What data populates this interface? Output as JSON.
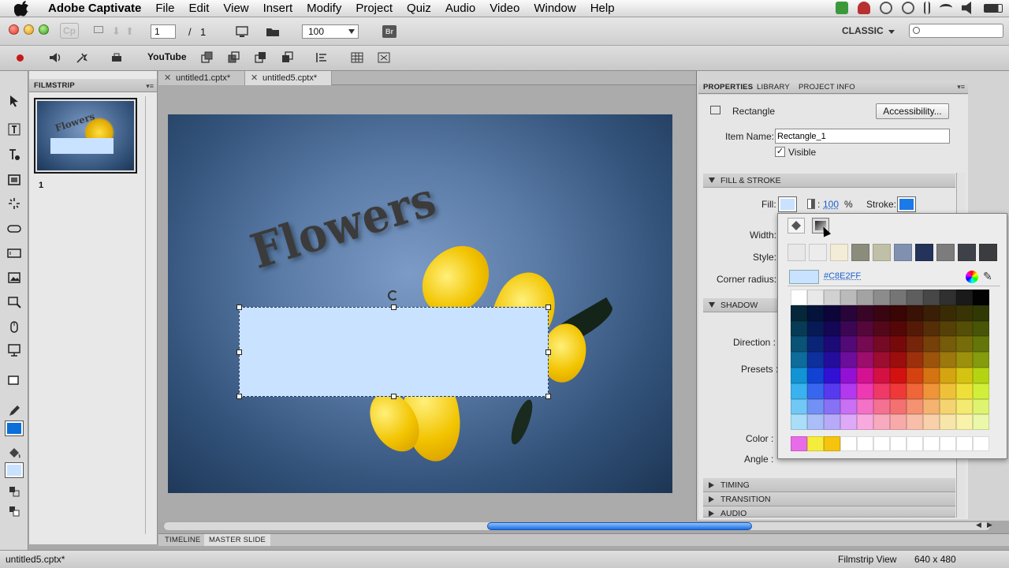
{
  "menubar": {
    "app_name": "Adobe Captivate",
    "menus": [
      "File",
      "Edit",
      "View",
      "Insert",
      "Modify",
      "Project",
      "Quiz",
      "Audio",
      "Video",
      "Window",
      "Help"
    ]
  },
  "toolbar": {
    "slide_current": "1",
    "slide_separator": "/",
    "slide_total": "1",
    "zoom": "100",
    "bridge_label": "Br",
    "youtube_label": "YouTube",
    "workspace": "CLASSIC",
    "search_placeholder": ""
  },
  "filmstrip": {
    "tab_label": "FILMSTRIP",
    "slides": [
      {
        "number": "1",
        "title_text": "Flowers"
      }
    ]
  },
  "documents": {
    "tabs": [
      {
        "label": "untitled1.cptx*",
        "active": false
      },
      {
        "label": "untitled5.cptx*",
        "active": true
      }
    ]
  },
  "slide": {
    "title_text": "Flowers",
    "rectangle_fill": "#C8E2FF"
  },
  "properties": {
    "tabs": [
      "PROPERTIES",
      "LIBRARY",
      "PROJECT INFO"
    ],
    "object_type": "Rectangle",
    "accessibility_button": "Accessibility...",
    "item_name_label": "Item Name:",
    "item_name_value": "Rectangle_1",
    "visible_label": "Visible",
    "visible_checked": true,
    "fill_stroke_section": "FILL & STROKE",
    "fill_label": "Fill:",
    "fill_alpha": "100",
    "percent": "%",
    "stroke_label": "Stroke:",
    "width_label": "Width:",
    "style_label": "Style:",
    "corner_radius_label": "Corner radius:",
    "shadow_section": "SHADOW",
    "direction_label": "Direction :",
    "presets_label": "Presets :",
    "color_label": "Color :",
    "angle_label": "Angle :",
    "timing_section": "TIMING",
    "transition_section": "TRANSITION",
    "audio_section": "AUDIO"
  },
  "color_picker": {
    "selected_hex": "#C8E2FF",
    "recent_colors": [
      "#e8e8e8",
      "#ececec",
      "#f3ecd6",
      "#8c8c7c",
      "#c0c0a8",
      "#8091b0",
      "#24335a",
      "#7c7c7c",
      "#3e4248",
      "#3a3c40"
    ],
    "custom_row": [
      "#e86ce8",
      "#f6ec3c",
      "#f6c40c",
      "#ffffff",
      "#ffffff",
      "#ffffff",
      "#ffffff",
      "#ffffff",
      "#ffffff",
      "#ffffff",
      "#ffffff",
      "#ffffff"
    ]
  },
  "bottom": {
    "tabs": [
      "TIMELINE",
      "MASTER SLIDE"
    ]
  },
  "status": {
    "filename": "untitled5.cptx*",
    "view": "Filmstrip View",
    "dimensions": "640 x 480"
  },
  "colors": {
    "accent": "#0a6fd8",
    "rect_fill": "#C8E2FF",
    "stroke_color": "#1a7ae8",
    "link": "#1a5fd0"
  }
}
